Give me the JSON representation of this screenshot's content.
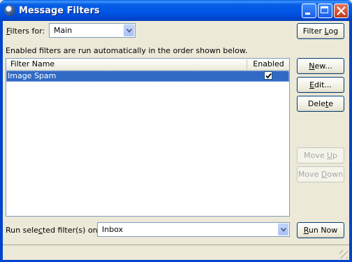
{
  "window": {
    "title": "Message Filters",
    "buttons": {
      "minimize": "minimize",
      "maximize": "maximize",
      "close": "close"
    }
  },
  "filters_for": {
    "label_pre": "",
    "label_accel": "F",
    "label_post": "ilters for:",
    "selected": "Main"
  },
  "filter_log_button": {
    "pre": "Filter ",
    "accel": "L",
    "post": "og"
  },
  "info_text": "Enabled filters are run automatically in the order shown below.",
  "list": {
    "columns": {
      "name": "Filter Name",
      "enabled": "Enabled"
    },
    "rows": [
      {
        "name": "Image Spam",
        "enabled": true,
        "selected": true
      }
    ]
  },
  "side_buttons": {
    "new": {
      "accel": "N",
      "post": "ew..."
    },
    "edit": {
      "accel": "E",
      "post": "dit..."
    },
    "delete": {
      "pre": "Dele",
      "accel": "t",
      "post": "e"
    },
    "move_up": {
      "pre": "Move ",
      "accel": "U",
      "post": "p"
    },
    "move_down": {
      "pre": "Move ",
      "accel": "D",
      "post": "own"
    }
  },
  "run_on": {
    "label_pre": "Run sele",
    "label_accel": "c",
    "label_post": "ted filter(s) on:",
    "selected": "Inbox"
  },
  "run_now_button": {
    "accel": "R",
    "post": "un Now"
  },
  "colors": {
    "titlebar": "#0054e3",
    "selection": "#316ac5",
    "face": "#ece9d8",
    "close": "#c4391b"
  }
}
